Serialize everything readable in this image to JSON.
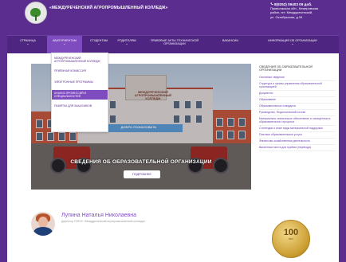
{
  "header": {
    "site_title": "«МЕЖДУРЕЧЕНСКИЙ АГРОПРОМЫШЛЕННЫЙ КОЛЛЕДЖ»",
    "phone": "8(8352) 09403 09 доб.",
    "address_line1": "Приволжская обл., Кемеровская",
    "address_line2": "район, пгт. Междуреченский,",
    "address_line3": "ул. Октябрьская, д.34"
  },
  "nav": {
    "items": [
      {
        "label": "СТРАНИЦА"
      },
      {
        "label": "АБИТУРИЕНТАМ"
      },
      {
        "label": "СТУДЕНТАМ"
      },
      {
        "label": "РОДИТЕЛЯМ"
      },
      {
        "label": "ПРАВОВЫЕ АКТЫ ТЕХНИЧЕСКОЙ ОРГАНИЗАЦИИ"
      },
      {
        "label": "ВАКАНСИИ"
      },
      {
        "label": "ИНФОРМАЦИЯ ОБ ОРГАНИЗАЦИИ"
      }
    ]
  },
  "dropdown": {
    "items": [
      {
        "label": "МЕЖДУРЕЧЕНСКИЙ АГРОПРОМЫШЛЕННЫЙ КОЛЛЕДЖ"
      },
      {
        "label": "ПРИЁМНАЯ КОМИССИЯ"
      },
      {
        "label": "ЭЛЕКТРОННЫЕ ПРОГРАММЫ"
      },
      {
        "label": "АНАЛИЗ ПРОФЕССИЙ И СПЕЦИАЛЬНОСТЕЙ"
      },
      {
        "label": "ПАМЯТКА ДЛЯ ЗАКАЗЧИКОВ"
      }
    ]
  },
  "slider": {
    "building_sign": "МЕЖДУРЕЧЕНСКИЙ АГРОПРОМЫШЛЕННЫЙ КОЛЛЕДЖ",
    "banner_text": "ДОБРО ПОЖАЛОВАТЬ",
    "title": "СВЕДЕНИЯ ОБ ОБРАЗОВАТЕЛЬНОЙ ОРГАНИЗАЦИИ",
    "button_label": "ПОДРОБНЕЕ"
  },
  "sidebar": {
    "title": "СВЕДЕНИЯ ОБ ОБРАЗОВАТЕЛЬНОЙ ОРГАНИЗАЦИИ",
    "links": [
      "Основные сведения",
      "Структура и органы управления образовательной организацией",
      "Документы",
      "Образование",
      "Образовательные стандарты",
      "Руководство. Педагогический состав",
      "Материально-техническое обеспечение и оснащённость образовательного процесса",
      "Стипендии и иные виды материальной поддержки",
      "Платные образовательные услуги",
      "Финансово-хозяйственная деятельность",
      "Вакантные места для приёма (перевода)"
    ]
  },
  "profile": {
    "name": "Лупина Наталья Николаевна",
    "role": "Директор ГБПОУ «Междуреченский агропромышленный колледж»"
  },
  "medal": {
    "number": "100",
    "sub": "ЛЕТ"
  },
  "colors": {
    "brand_purple": "#5b2d8e",
    "nav_purple": "#4e2580",
    "active_purple": "#7f4cc0"
  }
}
